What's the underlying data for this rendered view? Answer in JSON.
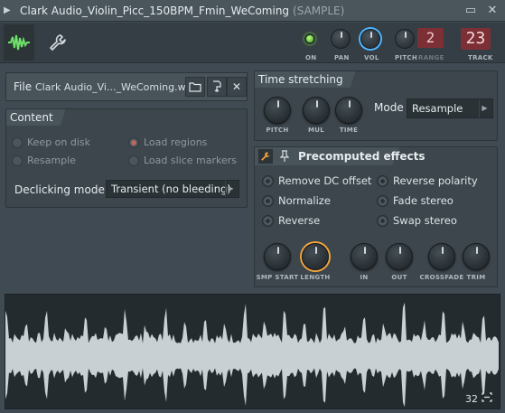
{
  "window": {
    "title": "Clark Audio_Violin_Picc_150BPM_Fmin_WeComing",
    "title_suffix": "(SAMPLE)"
  },
  "toolbar": {
    "on_label": "ON",
    "pan_label": "PAN",
    "vol_label": "VOL",
    "pitch_label": "PITCH",
    "range_label": "RANGE",
    "range_value": "2",
    "track_label": "TRACK",
    "track_value": "23"
  },
  "file": {
    "label": "File",
    "name": "Clark Audio_Vi..._WeComing.wav"
  },
  "content": {
    "title": "Content",
    "options": [
      {
        "label": "Keep on disk",
        "checked": false
      },
      {
        "label": "Load regions",
        "checked": true
      },
      {
        "label": "Resample",
        "checked": false
      },
      {
        "label": "Load slice markers",
        "checked": false
      }
    ],
    "declicking_label": "Declicking mode",
    "declicking_value": "Transient (no bleeding)"
  },
  "time_stretching": {
    "title": "Time stretching",
    "knobs": [
      "PITCH",
      "MUL",
      "TIME"
    ],
    "mode_label": "Mode",
    "mode_value": "Resample"
  },
  "precomputed": {
    "title": "Precomputed effects",
    "effects": [
      "Remove DC offset",
      "Reverse polarity",
      "Normalize",
      "Fade stereo",
      "Reverse",
      "Swap stereo"
    ],
    "knobs": [
      "SMP START",
      "LENGTH",
      "IN",
      "OUT",
      "CROSSFADE",
      "TRIM"
    ]
  },
  "waveform": {
    "bit_depth": "32"
  },
  "colors": {
    "accent_green": "#6de36a",
    "accent_blue": "#4fb6ff",
    "accent_orange": "#f3a53c",
    "display_red": "#7c2f34"
  }
}
